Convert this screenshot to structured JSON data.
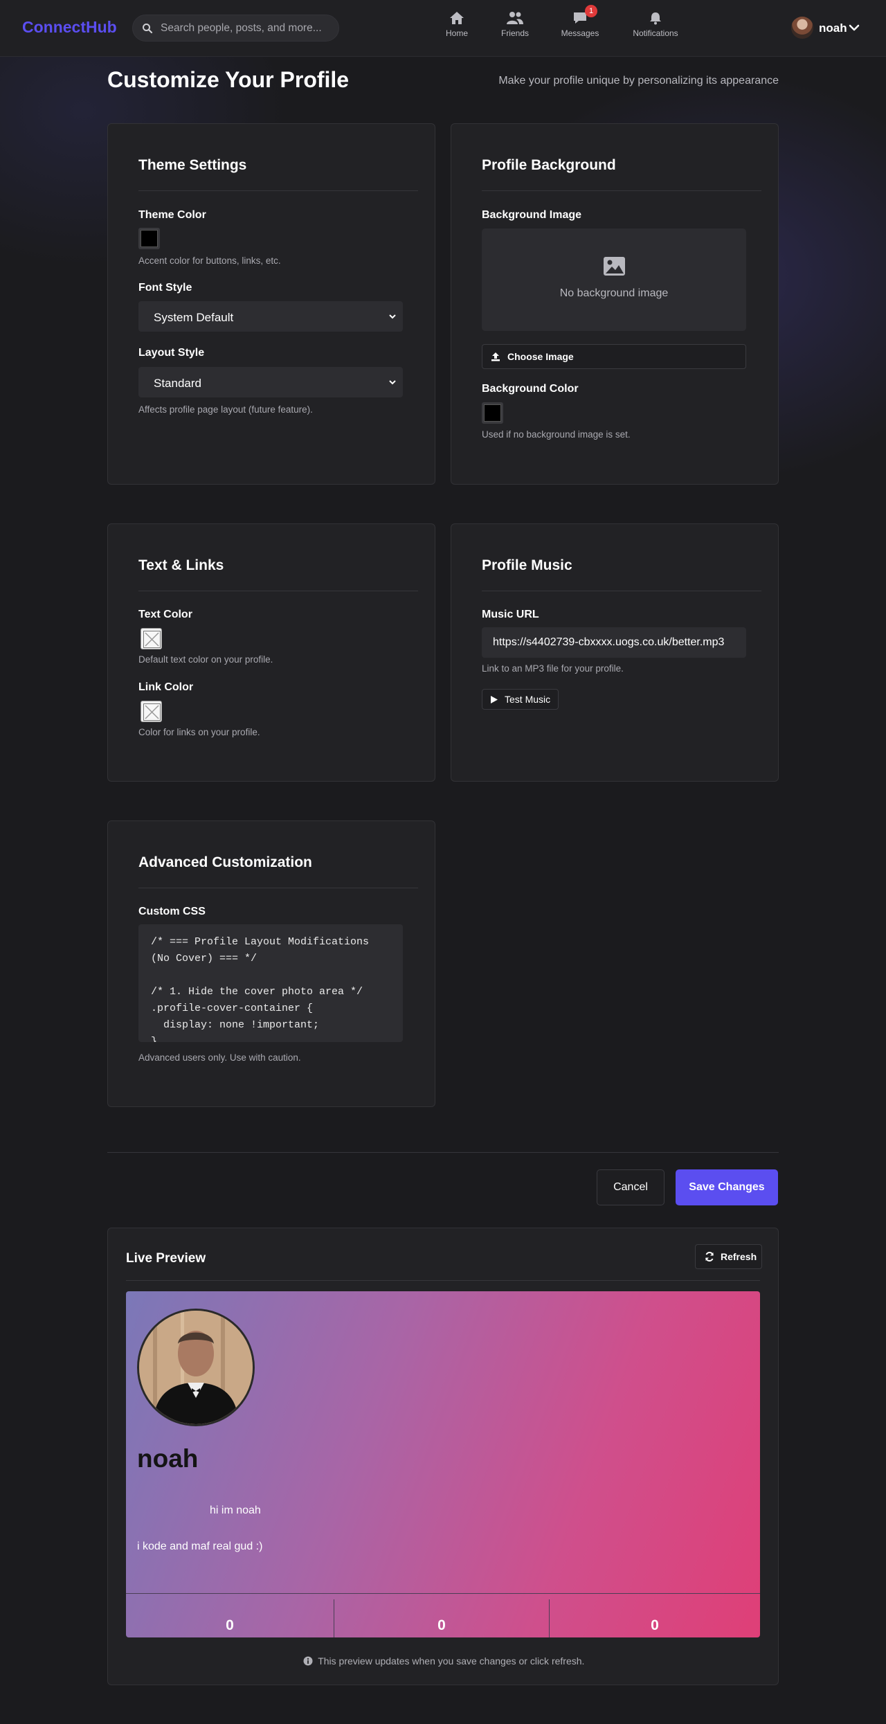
{
  "header": {
    "brand": "ConnectHub",
    "search_placeholder": "Search people, posts, and more...",
    "nav": [
      {
        "label": "Home",
        "icon": "home-icon"
      },
      {
        "label": "Friends",
        "icon": "friends-icon"
      },
      {
        "label": "Messages",
        "icon": "messages-icon",
        "badge": "1"
      },
      {
        "label": "Notifications",
        "icon": "bell-icon"
      }
    ],
    "username": "noah"
  },
  "page": {
    "title": "Customize Your Profile",
    "subtitle": "Make your profile unique by personalizing its appearance"
  },
  "theme": {
    "title": "Theme Settings",
    "color_label": "Theme Color",
    "color_value": "#000000",
    "color_help": "Accent color for buttons, links, etc.",
    "font_label": "Font Style",
    "font_value": "System Default",
    "layout_label": "Layout Style",
    "layout_value": "Standard",
    "layout_help": "Affects profile page layout (future feature)."
  },
  "background": {
    "title": "Profile Background",
    "image_label": "Background Image",
    "no_image": "No background image",
    "choose_button": "Choose Image",
    "color_label": "Background Color",
    "color_value": "#000000",
    "color_help": "Used if no background image is set."
  },
  "text_links": {
    "title": "Text & Links",
    "text_color_label": "Text Color",
    "text_color_help": "Default text color on your profile.",
    "link_color_label": "Link Color",
    "link_color_help": "Color for links on your profile."
  },
  "music": {
    "title": "Profile Music",
    "url_label": "Music URL",
    "url_value": "https://s4402739-cbxxxx.uogs.co.uk/better.mp3",
    "url_help": "Link to an MP3 file for your profile.",
    "test_button": "Test Music"
  },
  "advanced": {
    "title": "Advanced Customization",
    "css_label": "Custom CSS",
    "css_value": "/* === Profile Layout Modifications\n(No Cover) === */\n\n/* 1. Hide the cover photo area */\n.profile-cover-container {\n  display: none !important;\n}",
    "css_help": "Advanced users only. Use with caution."
  },
  "actions": {
    "cancel": "Cancel",
    "save": "Save Changes"
  },
  "preview": {
    "title": "Live Preview",
    "refresh": "Refresh",
    "name": "noah",
    "bio_line1": "hi im noah",
    "bio_line2": "i kode and maf real gud :)",
    "stats": [
      "0",
      "0",
      "0"
    ],
    "note": "This preview updates when you save changes or click refresh."
  },
  "colors": {
    "accent": "#5b4ef0",
    "badge": "#e03a3a",
    "background": "#1b1b1e",
    "card": "#222225"
  }
}
